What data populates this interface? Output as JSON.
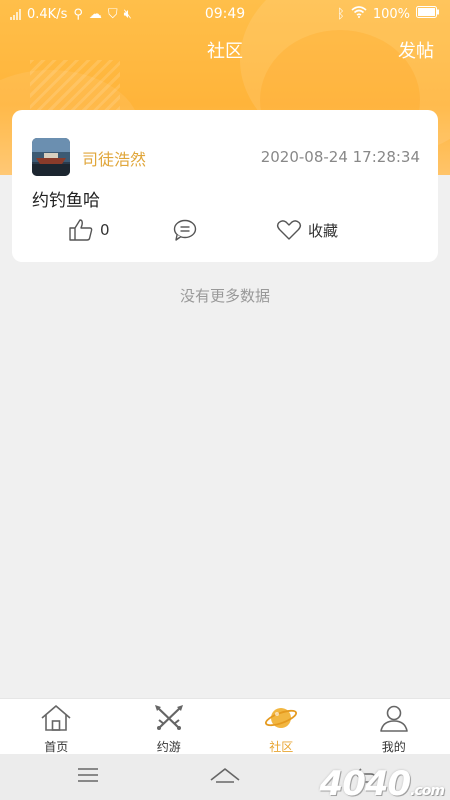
{
  "status_bar": {
    "net_speed": "0.4K/s",
    "time": "09:49",
    "battery": "100%"
  },
  "header": {
    "title": "社区",
    "post_button": "发帖"
  },
  "post": {
    "avatar_icon": "avatar-image",
    "username": "司徒浩然",
    "datetime": "2020-08-24 17:28:34",
    "content": "约钓鱼哈",
    "likes": "0",
    "comment_icon": "comment-icon",
    "favorite_label": "收藏"
  },
  "list_footer": "没有更多数据",
  "tabs": [
    {
      "label": "首页",
      "icon": "home-icon"
    },
    {
      "label": "约游",
      "icon": "crossed-swords-icon"
    },
    {
      "label": "社区",
      "icon": "planet-icon"
    },
    {
      "label": "我的",
      "icon": "person-icon"
    }
  ],
  "active_tab": "社区",
  "watermark": "4040",
  "watermark_suffix": ".com",
  "colors": {
    "accent": "#ffb43a",
    "username": "#e0a63a",
    "active_tab": "#e8a634"
  }
}
